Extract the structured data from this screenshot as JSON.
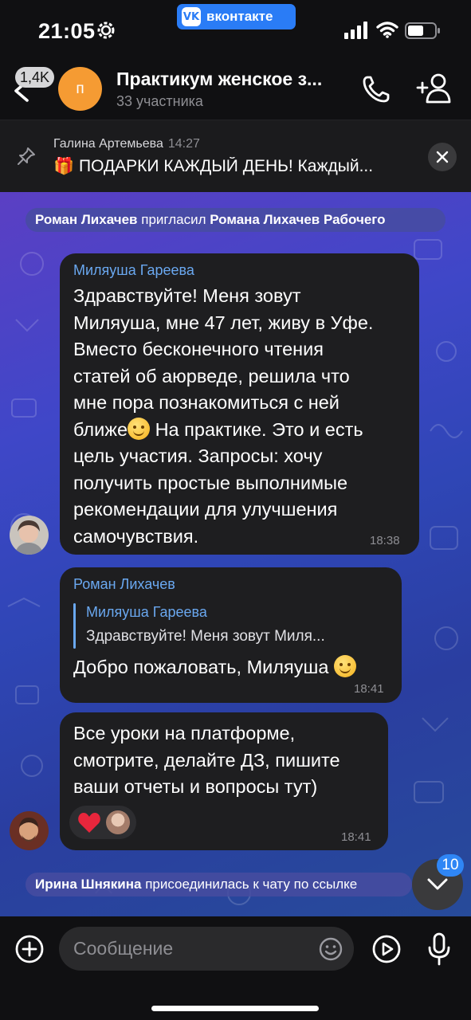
{
  "status_bar": {
    "time": "21:05",
    "app_label": "вконтакте",
    "vk_logo": "VK"
  },
  "header": {
    "unread_badge": "1,4K",
    "avatar_letter": "п",
    "title": "Практикум женское з...",
    "subtitle": "33 участника"
  },
  "pinned": {
    "author": "Галина Артемьева",
    "time": "14:27",
    "text": "🎁 ПОДАРКИ КАЖДЫЙ ДЕНЬ! Каждый..."
  },
  "messages": {
    "service_invite": {
      "actor": "Роман Лихачев",
      "action": "пригласил",
      "target": "Романа Лихачев Рабочего"
    },
    "msg1": {
      "sender": "Миляуша Гареева",
      "lines": [
        "Здравствуйте! Меня зовут",
        "Миляуша, мне 47 лет, живу в Уфе.",
        "Вместо бесконечного чтения",
        "статей об аюрведе, решила что",
        "мне пора познакомиться с ней",
        "ближе",
        " На практике. Это и есть",
        "цель участия. Запросы: хочу",
        "получить простые выполнимые",
        "рекомендации для улучшения",
        "самочувствия."
      ],
      "time": "18:38"
    },
    "msg2": {
      "sender": "Роман Лихачев",
      "reply_name": "Миляуша Гареева",
      "reply_text": "Здравствуйте! Меня зовут Миля...",
      "text": "Добро пожаловать, Миляуша ",
      "time": "18:41"
    },
    "msg3": {
      "lines": [
        "Все уроки на платформе,",
        "смотрите, делайте ДЗ, пишите",
        "ваши отчеты и вопросы тут)"
      ],
      "time": "18:41"
    },
    "service_join": {
      "actor": "Ирина Шнякина",
      "action": "присоединилась к чату по ссылке"
    }
  },
  "scroll_badge": "10",
  "composer": {
    "placeholder": "Сообщение"
  },
  "colors": {
    "accent": "#2a7cf6",
    "sender_name": "#6aa8f0",
    "bubble": "#1e1e20",
    "avatar_orange": "#f59b33"
  },
  "icons": [
    "gear-icon",
    "vk-logo-icon",
    "signal-icon",
    "wifi-icon",
    "battery-icon",
    "back-arrow-icon",
    "phone-icon",
    "add-user-icon",
    "pin-icon",
    "close-icon",
    "heart-icon",
    "chevron-down-icon",
    "plus-icon",
    "sticker-icon",
    "video-icon",
    "microphone-icon"
  ]
}
